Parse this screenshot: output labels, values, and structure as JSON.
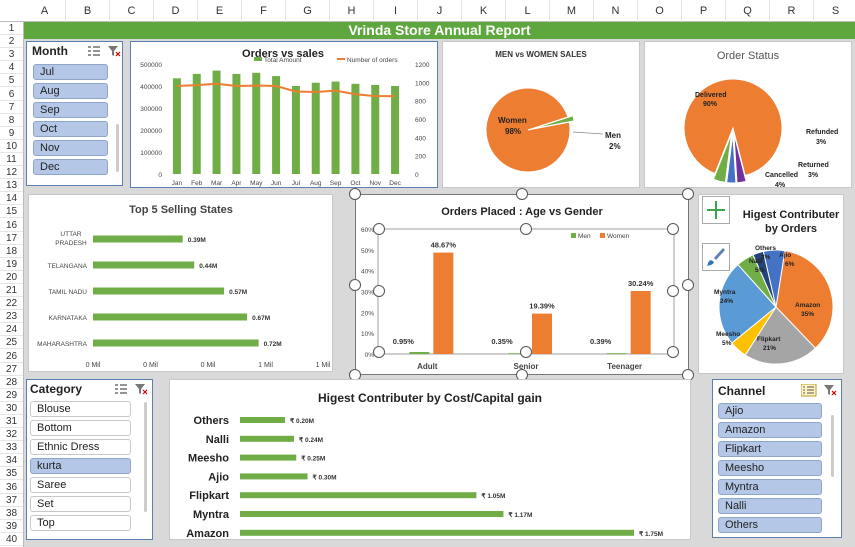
{
  "columns": [
    "A",
    "B",
    "C",
    "D",
    "E",
    "F",
    "G",
    "H",
    "I",
    "J",
    "K",
    "L",
    "M",
    "N",
    "O",
    "P",
    "Q",
    "R",
    "S"
  ],
  "rows": [
    "1",
    "2",
    "3",
    "4",
    "5",
    "6",
    "7",
    "8",
    "9",
    "10",
    "11",
    "12",
    "13",
    "14",
    "15",
    "16",
    "17",
    "18",
    "19",
    "20",
    "21",
    "22",
    "23",
    "24",
    "25",
    "26",
    "27",
    "28",
    "29",
    "30",
    "31",
    "32",
    "33",
    "34",
    "35",
    "36",
    "37",
    "38",
    "39",
    "40"
  ],
  "report_title": "Vrinda Store Annual Report",
  "month_slicer": {
    "title": "Month",
    "items": [
      {
        "label": "Jul",
        "selected": true
      },
      {
        "label": "Aug",
        "selected": true
      },
      {
        "label": "Sep",
        "selected": true
      },
      {
        "label": "Oct",
        "selected": true
      },
      {
        "label": "Nov",
        "selected": true
      },
      {
        "label": "Dec",
        "selected": true
      }
    ]
  },
  "category_slicer": {
    "title": "Category",
    "items": [
      {
        "label": "Blouse",
        "selected": false
      },
      {
        "label": "Bottom",
        "selected": false
      },
      {
        "label": "Ethnic Dress",
        "selected": false
      },
      {
        "label": "kurta",
        "selected": true
      },
      {
        "label": "Saree",
        "selected": false
      },
      {
        "label": "Set",
        "selected": false
      },
      {
        "label": "Top",
        "selected": false
      }
    ]
  },
  "channel_slicer": {
    "title": "Channel",
    "items": [
      {
        "label": "Ajio",
        "selected": true
      },
      {
        "label": "Amazon",
        "selected": true
      },
      {
        "label": "Flipkart",
        "selected": true
      },
      {
        "label": "Meesho",
        "selected": true
      },
      {
        "label": "Myntra",
        "selected": true
      },
      {
        "label": "Nalli",
        "selected": true
      },
      {
        "label": "Others",
        "selected": true
      }
    ]
  },
  "chart_data": [
    {
      "id": "orders_vs_sales",
      "type": "bar",
      "title": "Orders vs sales",
      "categories": [
        "Jan",
        "Feb",
        "Mar",
        "Apr",
        "May",
        "Jun",
        "Jul",
        "Aug",
        "Sep",
        "Oct",
        "Nov",
        "Dec"
      ],
      "series": [
        {
          "name": "Total Amount",
          "type": "bar",
          "color": "#70ad47",
          "values": [
            435000,
            455000,
            470000,
            455000,
            460000,
            445000,
            400000,
            415000,
            420000,
            410000,
            405000,
            400000
          ]
        },
        {
          "name": "Number of orders",
          "type": "line",
          "axis": "right",
          "color": "#ed7d31",
          "values": [
            960,
            970,
            985,
            960,
            965,
            960,
            900,
            895,
            910,
            870,
            850,
            850
          ]
        }
      ],
      "ylim": [
        0,
        500000
      ],
      "yticks": [
        "0",
        "100000",
        "200000",
        "300000",
        "400000",
        "500000"
      ],
      "y2lim": [
        0,
        1200
      ],
      "y2ticks": [
        "0",
        "200",
        "400",
        "600",
        "800",
        "1000",
        "1200"
      ]
    },
    {
      "id": "men_vs_women",
      "type": "pie",
      "title": "MEN vs WOMEN SALES",
      "slices": [
        {
          "label": "Women",
          "value": 98,
          "text": "98%",
          "color": "#ed7d31"
        },
        {
          "label": "Men",
          "value": 2,
          "text": "2%",
          "color": "#70ad47"
        }
      ]
    },
    {
      "id": "order_status",
      "type": "pie",
      "title": "Order Status",
      "slices": [
        {
          "label": "Delivered",
          "value": 90,
          "text": "90%",
          "color": "#ed7d31"
        },
        {
          "label": "Refunded",
          "value": 3,
          "text": "3%",
          "color": "#7030a0"
        },
        {
          "label": "Returned",
          "value": 3,
          "text": "3%",
          "color": "#4472c4"
        },
        {
          "label": "Cancelled",
          "value": 4,
          "text": "4%",
          "color": "#70ad47"
        }
      ]
    },
    {
      "id": "top5_states",
      "type": "bar",
      "orientation": "horizontal",
      "title": "Top 5 Selling States",
      "categories": [
        "UTTAR PRADESH",
        "TELANGANA",
        "TAMIL NADU",
        "KARNATAKA",
        "MAHARASHTRA"
      ],
      "values": [
        0.39,
        0.44,
        0.57,
        0.67,
        0.72
      ],
      "labels": [
        "0.39M",
        "0.44M",
        "0.57M",
        "0.67M",
        "0.72M"
      ],
      "xticks": [
        "0 Mil",
        "0 Mil",
        "0 Mil",
        "1 Mil",
        "1 Mil"
      ],
      "xlim": [
        0,
        1.0
      ],
      "color": "#70ad47"
    },
    {
      "id": "age_vs_gender",
      "type": "bar",
      "title": "Orders Placed : Age vs Gender",
      "categories": [
        "Adult",
        "Senior",
        "Teenager"
      ],
      "series": [
        {
          "name": "Men",
          "color": "#70ad47",
          "values": [
            0.95,
            0.35,
            0.39
          ],
          "labels": [
            "0.95%",
            "0.35%",
            "0.39%"
          ]
        },
        {
          "name": "Women",
          "color": "#ed7d31",
          "values": [
            48.67,
            19.39,
            30.24
          ],
          "labels": [
            "48.67%",
            "19.39%",
            "30.24%"
          ]
        }
      ],
      "ylim": [
        0,
        60
      ],
      "yticks": [
        "0%",
        "10%",
        "20%",
        "30%",
        "40%",
        "50%",
        "60%"
      ]
    },
    {
      "id": "contributer_orders",
      "type": "pie",
      "title": "Higest Contributer by Orders",
      "slices": [
        {
          "label": "Amazon",
          "value": 35,
          "text": "35%",
          "color": "#ed7d31"
        },
        {
          "label": "Flipkart",
          "value": 21,
          "text": "21%",
          "color": "#a5a5a5"
        },
        {
          "label": "Meesho",
          "value": 5,
          "text": "5%",
          "color": "#ffc000"
        },
        {
          "label": "Myntra",
          "value": 24,
          "text": "24%",
          "color": "#5b9bd5"
        },
        {
          "label": "Nalli",
          "value": 5,
          "text": "5%",
          "color": "#70ad47"
        },
        {
          "label": "Others",
          "value": 3,
          "text": "3%",
          "color": "#264478"
        },
        {
          "label": "Ajio",
          "value": 6,
          "text": "6%",
          "color": "#4472c4"
        }
      ]
    },
    {
      "id": "contributer_cost",
      "type": "bar",
      "orientation": "horizontal",
      "title": "Higest Contributer by Cost/Capital gain",
      "categories": [
        "Others",
        "Nalli",
        "Meesho",
        "Ajio",
        "Flipkart",
        "Myntra",
        "Amazon"
      ],
      "values": [
        0.2,
        0.24,
        0.25,
        0.3,
        1.05,
        1.17,
        1.75
      ],
      "labels": [
        "₹ 0.20M",
        "₹ 0.24M",
        "₹ 0.25M",
        "₹ 0.30M",
        "₹ 1.05M",
        "₹ 1.17M",
        "₹ 1.75M"
      ],
      "color": "#70ad47"
    }
  ]
}
